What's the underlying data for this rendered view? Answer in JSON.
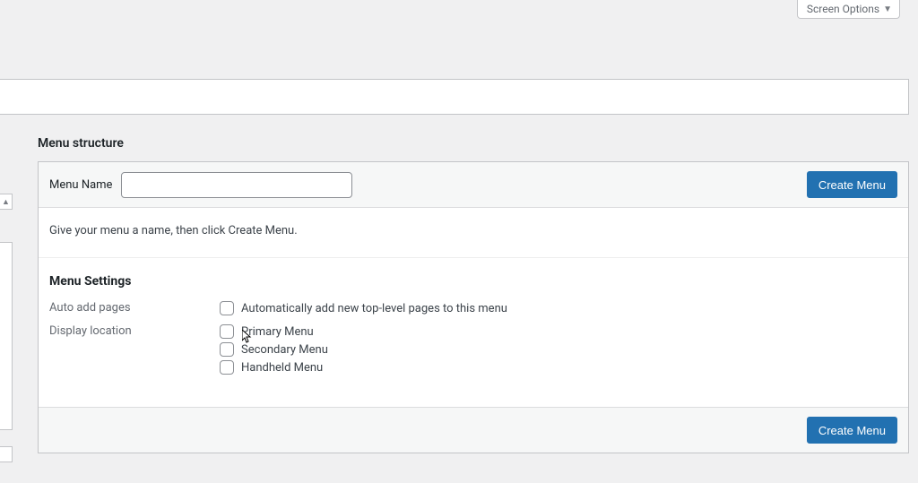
{
  "screen_options_label": "Screen Options",
  "section_title": "Menu structure",
  "menu_name_label": "Menu Name",
  "menu_name_value": "",
  "create_menu_button": "Create Menu",
  "menu_description": "Give your menu a name, then click Create Menu.",
  "menu_settings_title": "Menu Settings",
  "settings": {
    "auto_add": {
      "key": "Auto add pages",
      "option": "Automatically add new top-level pages to this menu"
    },
    "display_location": {
      "key": "Display location",
      "options": [
        "Primary Menu",
        "Secondary Menu",
        "Handheld Menu"
      ]
    }
  }
}
